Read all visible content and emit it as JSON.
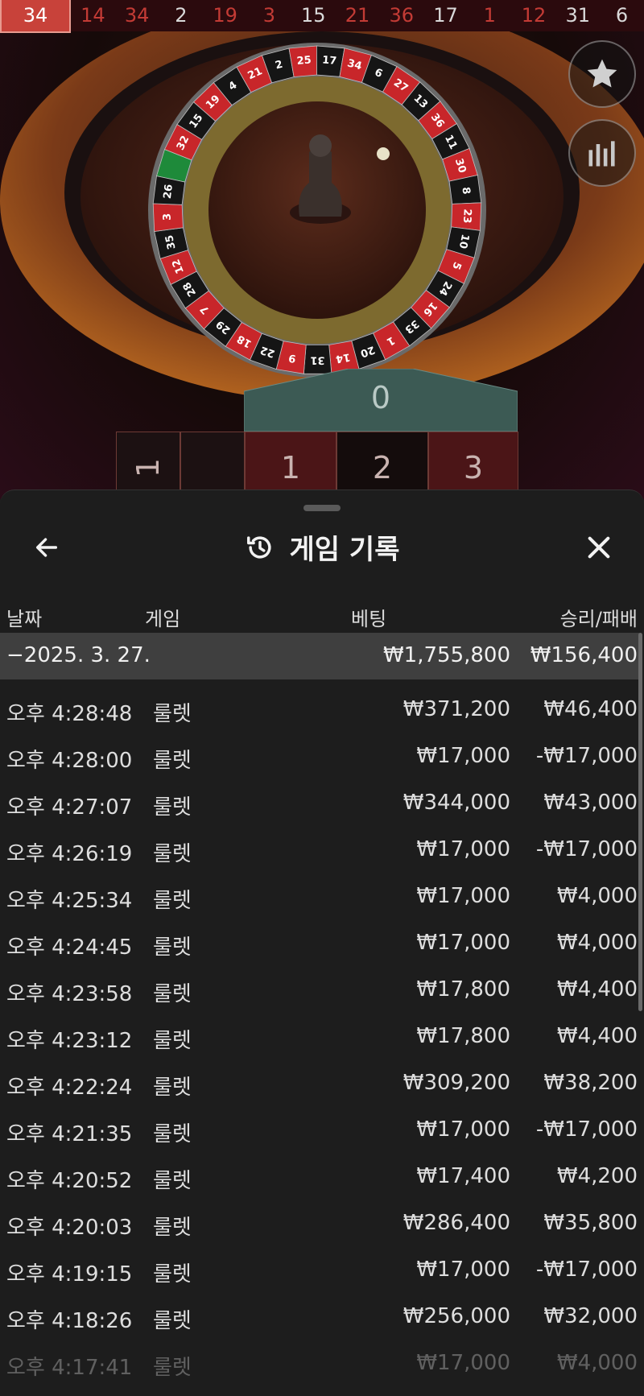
{
  "results_bar": [
    {
      "value": "34",
      "color": "red",
      "latest": true
    },
    {
      "value": "14",
      "color": "red"
    },
    {
      "value": "34",
      "color": "red"
    },
    {
      "value": "2",
      "color": "black"
    },
    {
      "value": "19",
      "color": "red"
    },
    {
      "value": "3",
      "color": "red"
    },
    {
      "value": "15",
      "color": "black"
    },
    {
      "value": "21",
      "color": "red"
    },
    {
      "value": "36",
      "color": "red"
    },
    {
      "value": "17",
      "color": "black"
    },
    {
      "value": "1",
      "color": "red"
    },
    {
      "value": "12",
      "color": "red"
    },
    {
      "value": "31",
      "color": "black"
    },
    {
      "value": "6",
      "color": "black"
    }
  ],
  "wheel_numbers": [
    "32",
    "15",
    "19",
    "4",
    "21",
    "2",
    "25",
    "17",
    "34",
    "6",
    "27",
    "13",
    "36",
    "11",
    "30",
    "8",
    "23",
    "10",
    "5",
    "24",
    "16",
    "33",
    "1",
    "20",
    "14",
    "31",
    "9",
    "22",
    "18",
    "29",
    "7",
    "28",
    "12",
    "35",
    "3",
    "26"
  ],
  "side_buttons": {
    "favorites_icon": "star-icon",
    "stats_icon": "statistics-icon"
  },
  "betting_table": {
    "zero": "0",
    "left_label": "1",
    "cells": [
      "1",
      "2",
      "3"
    ]
  },
  "history_sheet": {
    "title": "게임 기록",
    "title_icon": "history-icon",
    "back_icon": "back-arrow-icon",
    "close_icon": "close-icon",
    "columns": {
      "date": "날짜",
      "game": "게임",
      "bet": "베팅",
      "result": "승리/패배"
    },
    "summary": {
      "date": "−2025. 3. 27.",
      "bet": "₩1,755,800",
      "result": "₩156,400"
    },
    "rows": [
      {
        "time": "오후 4:28:48",
        "game": "룰렛",
        "bet": "₩371,200",
        "result": "₩46,400"
      },
      {
        "time": "오후 4:28:00",
        "game": "룰렛",
        "bet": "₩17,000",
        "result": "-₩17,000"
      },
      {
        "time": "오후 4:27:07",
        "game": "룰렛",
        "bet": "₩344,000",
        "result": "₩43,000"
      },
      {
        "time": "오후 4:26:19",
        "game": "룰렛",
        "bet": "₩17,000",
        "result": "-₩17,000"
      },
      {
        "time": "오후 4:25:34",
        "game": "룰렛",
        "bet": "₩17,000",
        "result": "₩4,000"
      },
      {
        "time": "오후 4:24:45",
        "game": "룰렛",
        "bet": "₩17,000",
        "result": "₩4,000"
      },
      {
        "time": "오후 4:23:58",
        "game": "룰렛",
        "bet": "₩17,800",
        "result": "₩4,400"
      },
      {
        "time": "오후 4:23:12",
        "game": "룰렛",
        "bet": "₩17,800",
        "result": "₩4,400"
      },
      {
        "time": "오후 4:22:24",
        "game": "룰렛",
        "bet": "₩309,200",
        "result": "₩38,200"
      },
      {
        "time": "오후 4:21:35",
        "game": "룰렛",
        "bet": "₩17,000",
        "result": "-₩17,000"
      },
      {
        "time": "오후 4:20:52",
        "game": "룰렛",
        "bet": "₩17,400",
        "result": "₩4,200"
      },
      {
        "time": "오후 4:20:03",
        "game": "룰렛",
        "bet": "₩286,400",
        "result": "₩35,800"
      },
      {
        "time": "오후 4:19:15",
        "game": "룰렛",
        "bet": "₩17,000",
        "result": "-₩17,000"
      },
      {
        "time": "오후 4:18:26",
        "game": "룰렛",
        "bet": "₩256,000",
        "result": "₩32,000"
      },
      {
        "time": "오후 4:17:41",
        "game": "룰렛",
        "bet": "₩17,000",
        "result": "₩4,000"
      }
    ]
  }
}
